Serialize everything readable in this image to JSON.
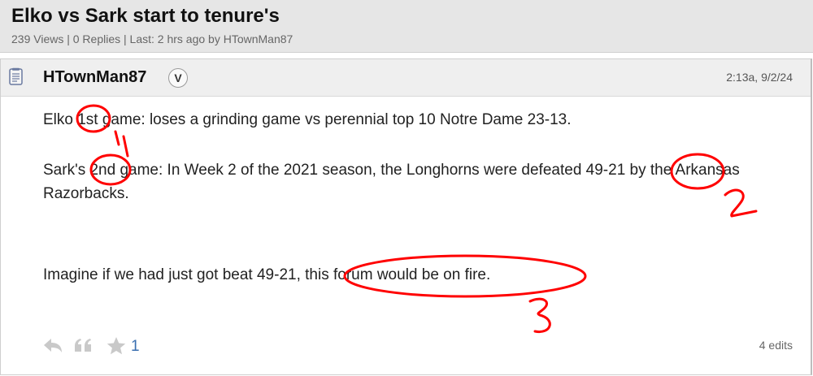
{
  "thread": {
    "title": "Elko vs Sark start to tenure's",
    "meta": "239 Views | 0 Replies | Last: 2 hrs ago by HTownMan87"
  },
  "post": {
    "username": "HTownMan87",
    "badge": "V",
    "timestamp": "2:13a, 9/2/24",
    "paragraphs": [
      "Elko 1st game: loses a grinding game vs perennial top 10 Notre Dame 23-13.",
      "Sark's 2nd game: In Week 2 of the 2021 season, the Longhorns were defeated 49-21 by the Arkansas Razorbacks.",
      "Imagine if we had just got beat 49-21, this forum would be on fire."
    ],
    "like_count": "1",
    "edits": "4 edits"
  },
  "icons": {
    "post_type": "document-icon",
    "reply": "reply-arrow-icon",
    "quote": "quote-icon",
    "star": "star-icon"
  },
  "annotations": {
    "color": "#ff0000",
    "labels": [
      "1",
      "2",
      "3"
    ]
  },
  "colors": {
    "header_bg": "#e6e6e6",
    "post_header_bg": "#efefef",
    "link_blue": "#3a6fb0"
  }
}
